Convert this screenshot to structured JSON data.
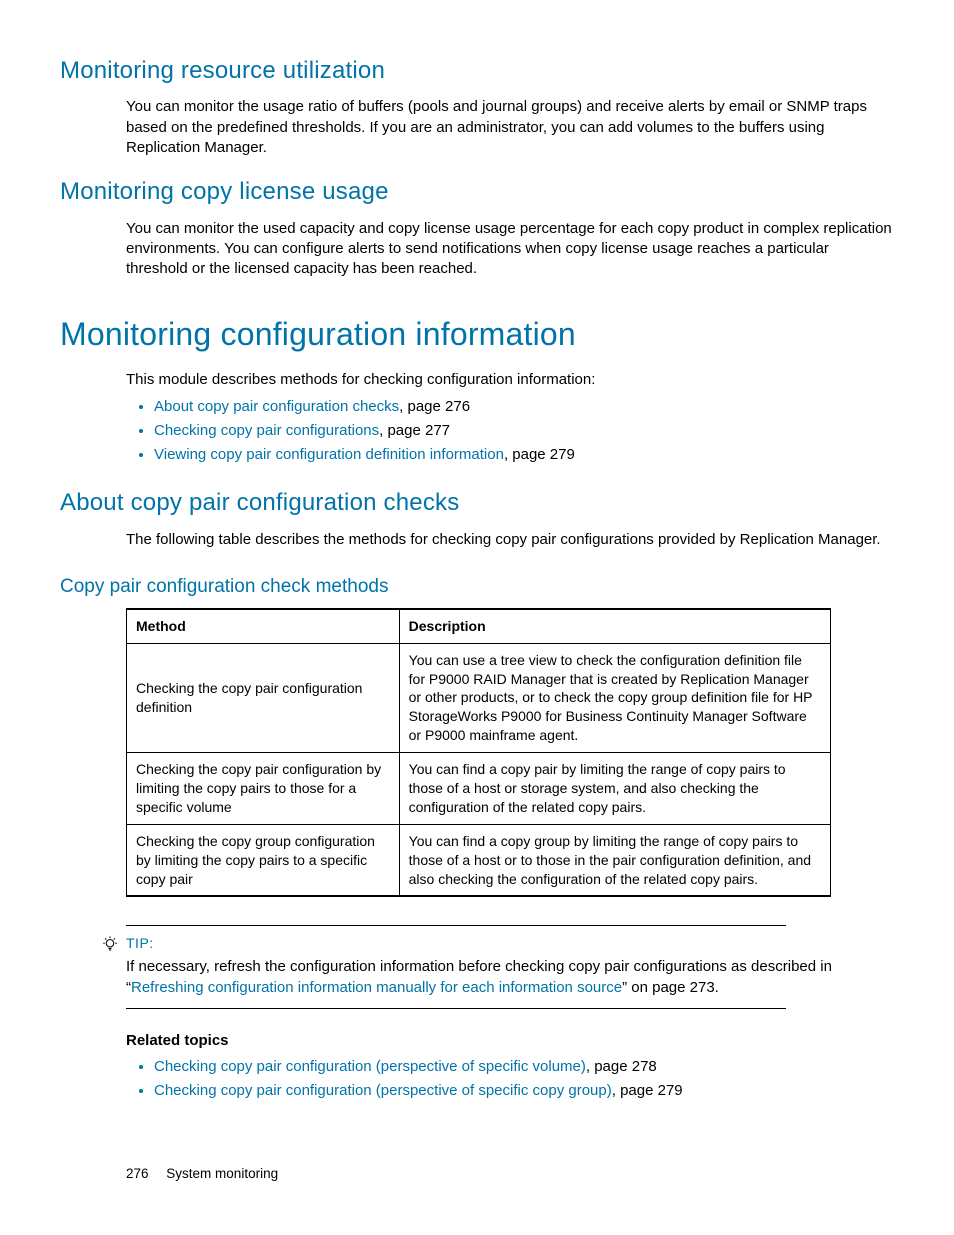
{
  "sections": {
    "s1": {
      "title": "Monitoring resource utilization",
      "body": "You can monitor the usage ratio of buffers (pools and journal groups) and receive alerts by email or SNMP traps based on the predefined thresholds. If you are an administrator, you can add volumes to the buffers using Replication Manager."
    },
    "s2": {
      "title": "Monitoring copy license usage",
      "body": "You can monitor the used capacity and copy license usage percentage for each copy product in complex replication environments. You can configure alerts to send notifications when copy license usage reaches a particular threshold or the licensed capacity has been reached."
    },
    "s3": {
      "title": "Monitoring configuration information",
      "intro": "This module describes methods for checking configuration information:",
      "links": [
        {
          "text": "About copy pair configuration checks",
          "suffix": ", page 276"
        },
        {
          "text": "Checking copy pair configurations",
          "suffix": ", page 277"
        },
        {
          "text": "Viewing copy pair configuration definition information",
          "suffix": ", page 279"
        }
      ]
    },
    "s4": {
      "title": "About copy pair configuration checks",
      "body": "The following table describes the methods for checking copy pair configurations provided by Replication Manager."
    },
    "s5": {
      "title": "Copy pair configuration check methods"
    }
  },
  "table": {
    "headers": {
      "method": "Method",
      "description": "Description"
    },
    "rows": [
      {
        "method": "Checking the copy pair configuration definition",
        "description": "You can use a tree view to check the configuration definition file for P9000 RAID Manager that is created by Replication Manager or other products, or to check the copy group definition file for HP StorageWorks P9000 for Business Continuity Manager Software or P9000 mainframe agent."
      },
      {
        "method": "Checking the copy pair configuration by limiting the copy pairs to those for a specific volume",
        "description": "You can find a copy pair by limiting the range of copy pairs to those of a host or storage system, and also checking the configuration of the related copy pairs."
      },
      {
        "method": "Checking the copy group configuration by limiting the copy pairs to a specific copy pair",
        "description": "You can find a copy group by limiting the range of copy pairs to those of a host or to those in the pair configuration definition, and also checking the configuration of the related copy pairs."
      }
    ]
  },
  "tip": {
    "label": "TIP:",
    "pre": "If necessary, refresh the configuration information before checking copy pair configurations as described in “",
    "link": "Refreshing configuration information manually for each information source",
    "post": "” on page 273."
  },
  "related": {
    "heading": "Related topics",
    "items": [
      {
        "text": "Checking copy pair configuration (perspective of specific volume)",
        "suffix": ", page 278"
      },
      {
        "text": "Checking copy pair configuration (perspective of specific copy group)",
        "suffix": ", page 279"
      }
    ]
  },
  "footer": {
    "page": "276",
    "section": "System monitoring"
  }
}
